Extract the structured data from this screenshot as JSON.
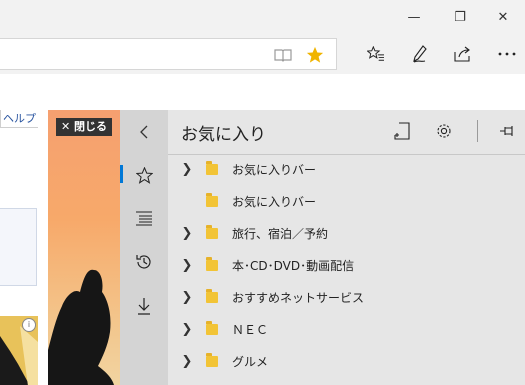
{
  "window": {
    "minimize_glyph": "—",
    "maximize_glyph": "❐",
    "close_glyph": "✕"
  },
  "toolbar": {
    "reading_view_icon": "book-icon",
    "favorite_star_color": "#f0b400",
    "hub_icon": "hub-icon",
    "notes_icon": "pen-icon",
    "share_icon": "share-icon"
  },
  "page": {
    "help_link": "ヘルプ",
    "ad_close_label": "✕ 閉じる"
  },
  "hub": {
    "title": "お気に入り",
    "accent_color": "#0078d7",
    "items": [
      {
        "label": "お気に入りバー",
        "expandable": true
      },
      {
        "label": "お気に入りバー",
        "expandable": false
      },
      {
        "label": "旅行、宿泊／予約",
        "expandable": true
      },
      {
        "label": "本･CD･DVD･動画配信",
        "expandable": true
      },
      {
        "label": "おすすめネットサービス",
        "expandable": true
      },
      {
        "label": "ＮＥＣ",
        "expandable": true
      },
      {
        "label": "グルメ",
        "expandable": true
      }
    ]
  }
}
